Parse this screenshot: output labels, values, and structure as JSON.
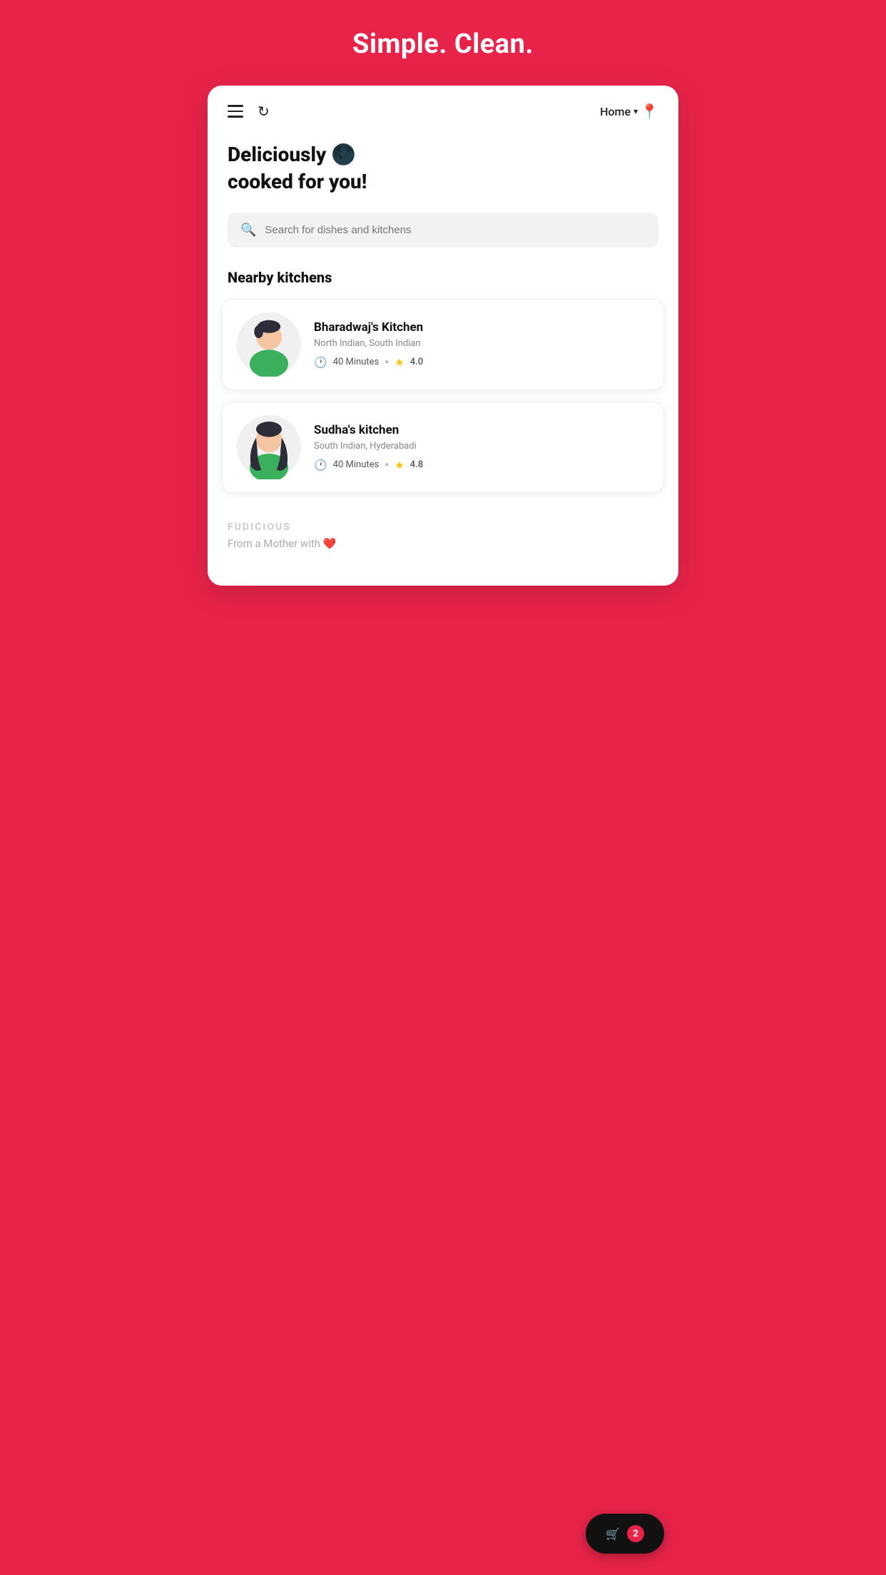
{
  "hero": {
    "title": "Simple. Clean."
  },
  "header": {
    "location_label": "Home",
    "chevron": "▾"
  },
  "greeting": {
    "line1": "Deliciously 🌑",
    "line2": "cooked for you!"
  },
  "search": {
    "placeholder": "Search for dishes and kitchens"
  },
  "nearby_section": {
    "title": "Nearby kitchens"
  },
  "kitchens": [
    {
      "name": "Bharadwaj's Kitchen",
      "cuisine": "North Indian, South Indian",
      "time": "40 Minutes",
      "rating": "4.0",
      "avatar_type": "male"
    },
    {
      "name": "Sudha's kitchen",
      "cuisine": "South Indian, Hyderabadi",
      "time": "40 Minutes",
      "rating": "4.8",
      "avatar_type": "female"
    }
  ],
  "footer": {
    "brand": "FUDICIOUS",
    "tagline": "From a Mother with ❤️"
  },
  "cart": {
    "icon": "🛒",
    "count": "2"
  }
}
